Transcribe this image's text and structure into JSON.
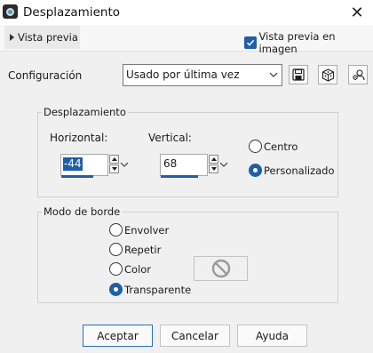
{
  "window": {
    "title": "Desplazamiento",
    "close_glyph": "✕",
    "icon": "app-camera-icon"
  },
  "preview": {
    "toggle_label": "Vista previa",
    "image_check_label": "Vista previa en imagen",
    "image_check_checked": true
  },
  "config": {
    "label": "Configuración",
    "selected": "Usado por última vez",
    "tools": [
      "save-icon",
      "dice-icon",
      "user-settings-icon"
    ]
  },
  "offset": {
    "title": "Desplazamiento",
    "horizontal_label": "Horizontal:",
    "horizontal_value": "-44",
    "vertical_label": "Vertical:",
    "vertical_value": "68",
    "mode_options": [
      {
        "label": "Centro",
        "selected": false
      },
      {
        "label": "Personalizado",
        "selected": true
      }
    ]
  },
  "edge_mode": {
    "title": "Modo de borde",
    "options": [
      {
        "label": "Envolver",
        "selected": false
      },
      {
        "label": "Repetir",
        "selected": false
      },
      {
        "label": "Color",
        "selected": false
      },
      {
        "label": "Transparente",
        "selected": true
      }
    ],
    "color_disabled_icon": "no-symbol-icon"
  },
  "buttons": {
    "ok": "Aceptar",
    "cancel": "Cancelar",
    "help": "Ayuda"
  },
  "colors": {
    "accent": "#1f5fa8",
    "background": "#f0f0f0"
  }
}
